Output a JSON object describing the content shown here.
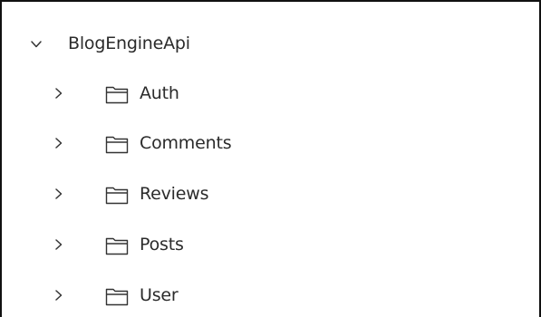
{
  "tree": {
    "root": {
      "label": "BlogEngineApi",
      "expanded": true,
      "icon": "chevron-down-icon"
    },
    "children": [
      {
        "label": "Auth",
        "icon": "folder-icon",
        "expanded": false
      },
      {
        "label": "Comments",
        "icon": "folder-icon",
        "expanded": false
      },
      {
        "label": "Reviews",
        "icon": "folder-icon",
        "expanded": false
      },
      {
        "label": "Posts",
        "icon": "folder-icon",
        "expanded": false
      },
      {
        "label": "User",
        "icon": "folder-icon",
        "expanded": false
      }
    ]
  },
  "colors": {
    "text": "#2b2b2b",
    "icon_stroke": "#333333",
    "border": "#111111",
    "background": "#ffffff"
  }
}
